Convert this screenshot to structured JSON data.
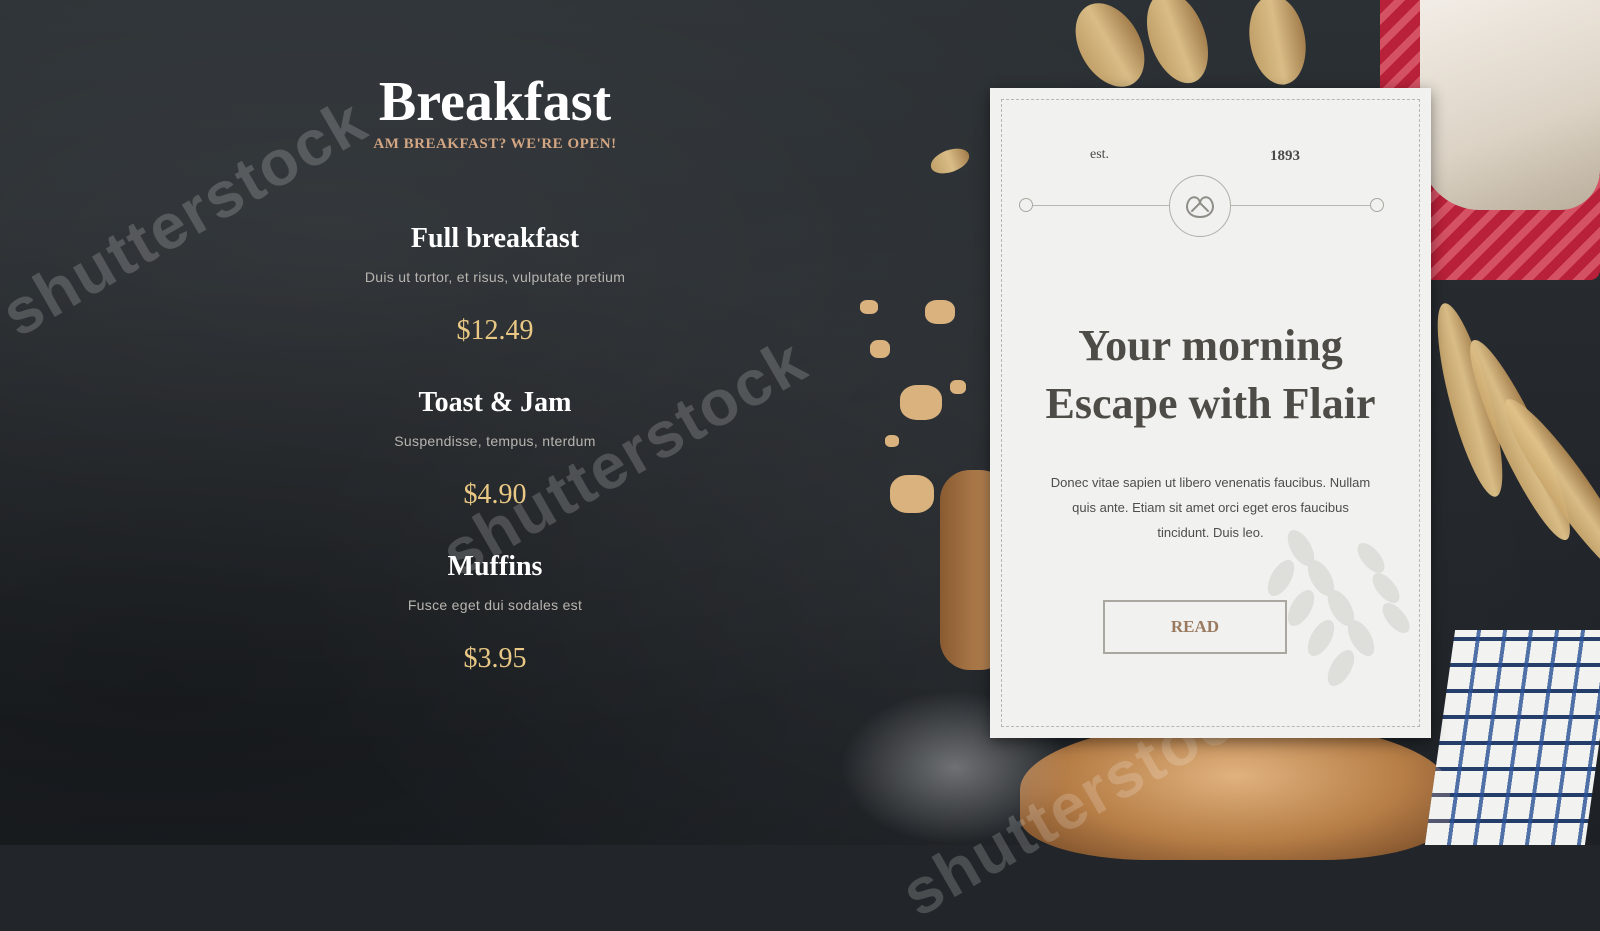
{
  "menu": {
    "title": "Breakfast",
    "subtitle": "AM BREAKFAST? WE'RE OPEN!",
    "items": [
      {
        "name": "Full breakfast",
        "description": "Duis ut tortor, et risus, vulputate pretium",
        "price": "$12.49"
      },
      {
        "name": "Toast & Jam",
        "description": "Suspendisse, tempus, nterdum",
        "price": "$4.90"
      },
      {
        "name": "Muffins",
        "description": "Fusce eget dui sodales est",
        "price": "$3.95"
      }
    ]
  },
  "card": {
    "est_label": "est.",
    "year": "1893",
    "title_line1": "Your morning",
    "title_line2": "Escape with Flair",
    "body": "Donec vitae sapien ut libero venenatis faucibus. Nullam quis ante. Etiam sit amet orci eget eros faucibus tincidunt. Duis leo.",
    "button_label": "READ",
    "emblem_icon": "pretzel-icon"
  },
  "watermark": "shutterstock",
  "colors": {
    "accent_subtitle": "#d2a583",
    "price": "#e8c884",
    "card_bg": "#f1f1ef",
    "button_text": "#9a7a5e"
  }
}
